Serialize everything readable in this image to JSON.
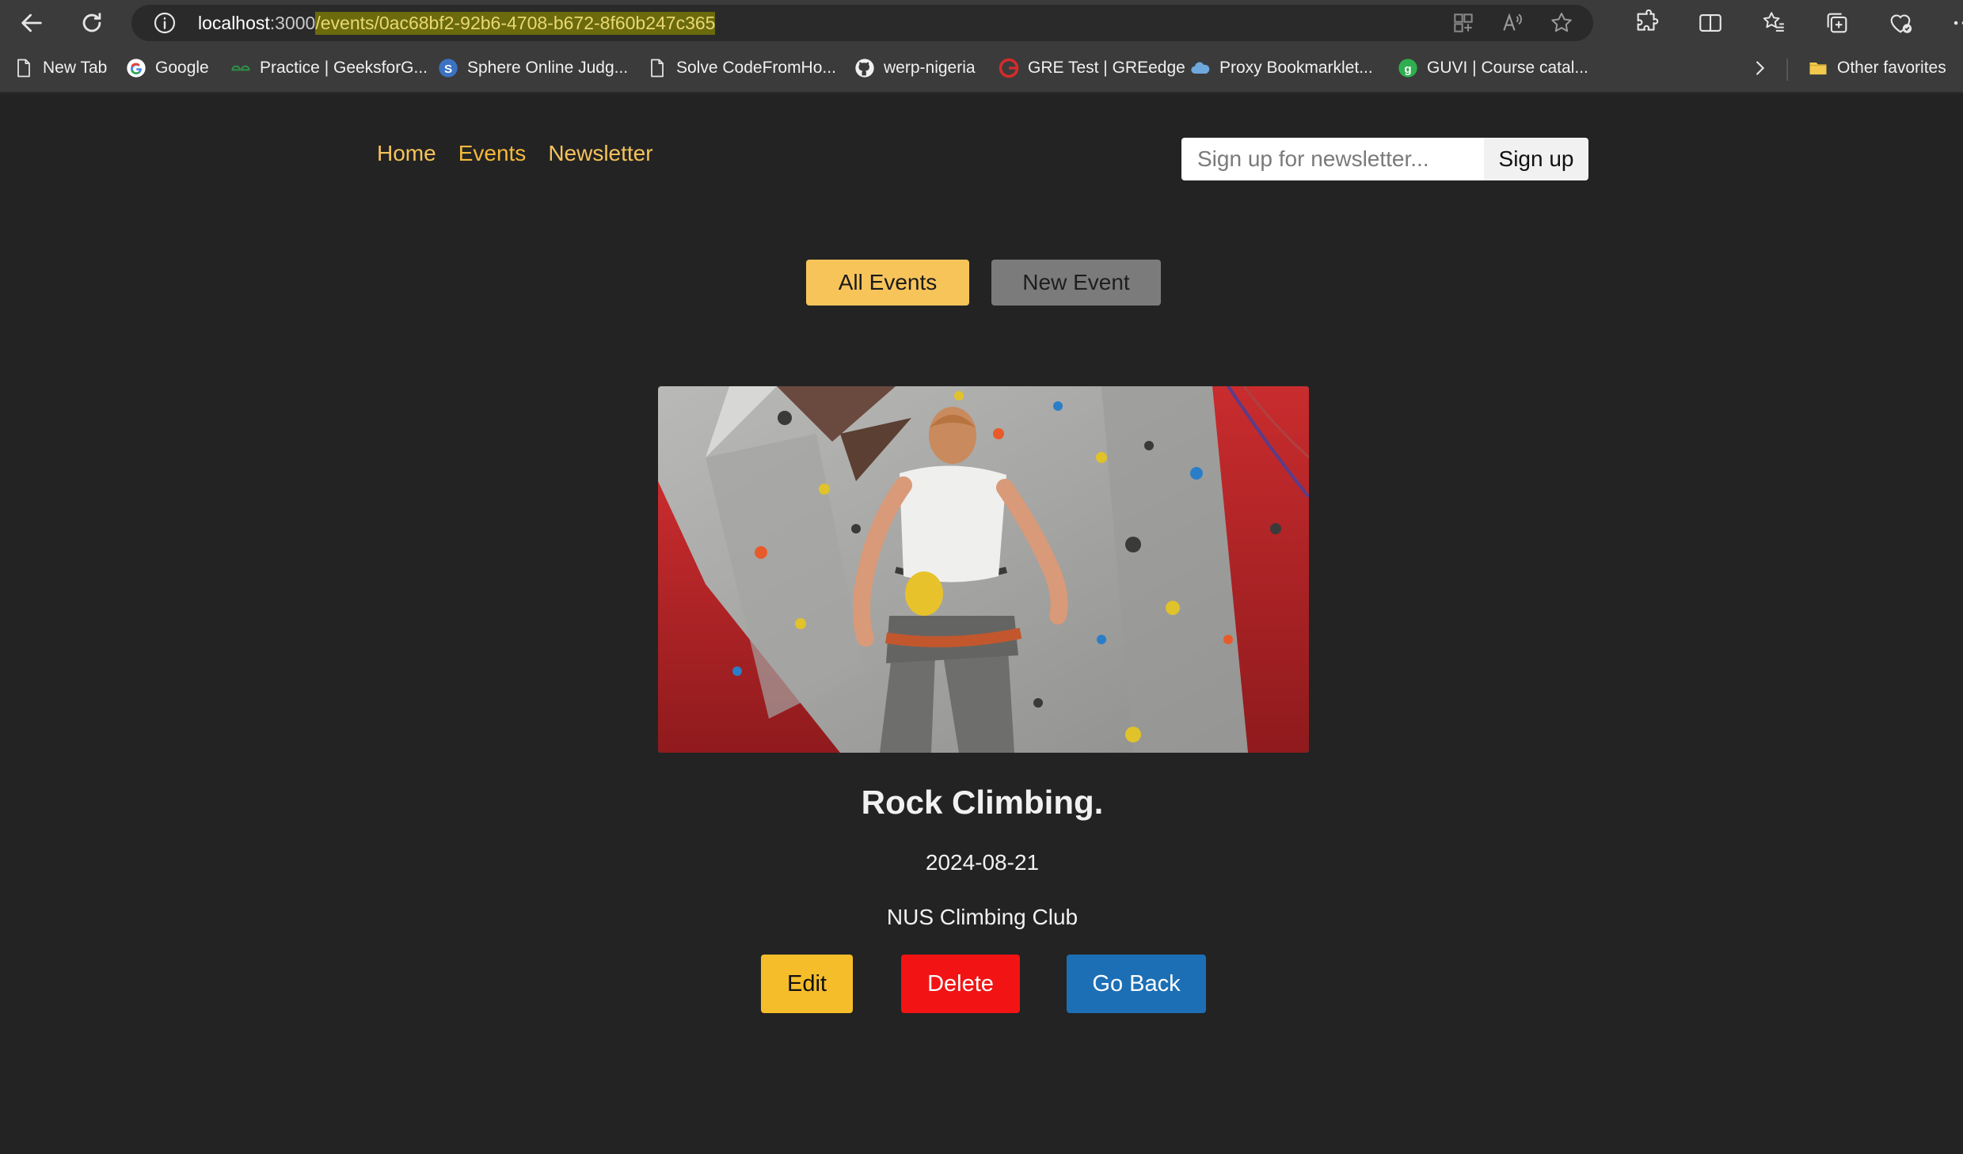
{
  "browser": {
    "url": {
      "host": "localhost",
      "port": ":3000",
      "path": "/events/0ac68bf2-92b6-4708-b672-8f60b247c365"
    },
    "bookmarks": [
      {
        "label": "New Tab",
        "icon": "page-icon"
      },
      {
        "label": "Google",
        "icon": "google-icon"
      },
      {
        "label": "Practice | GeeksforG...",
        "icon": "geeksforgeeks-icon"
      },
      {
        "label": "Sphere Online Judg...",
        "icon": "spoj-icon"
      },
      {
        "label": "Solve CodeFromHo...",
        "icon": "page-icon"
      },
      {
        "label": "werp-nigeria",
        "icon": "github-icon"
      },
      {
        "label": "GRE Test | GREedge",
        "icon": "greedge-icon"
      },
      {
        "label": "Proxy Bookmarklet...",
        "icon": "cloud-icon"
      },
      {
        "label": "GUVI | Course catal...",
        "icon": "guvi-icon"
      }
    ],
    "other_favorites": "Other favorites"
  },
  "nav": {
    "home": "Home",
    "events": "Events",
    "newsletter": "Newsletter"
  },
  "newsletter": {
    "placeholder": "Sign up for newsletter...",
    "button": "Sign up"
  },
  "tabs": {
    "all_events": "All Events",
    "new_event": "New Event"
  },
  "event": {
    "image": "rock-climbing-photo",
    "title": "Rock Climbing.",
    "date": "2024-08-21",
    "organizer": "NUS Climbing Club"
  },
  "actions": {
    "edit": "Edit",
    "delete": "Delete",
    "go_back": "Go Back"
  },
  "colors": {
    "page_bg": "#232323",
    "nav_link": "#f5c35b",
    "all_events": "#f7c45a",
    "new_event": "#7b7b7b",
    "edit": "#f6bd2b",
    "delete": "#f21414",
    "go_back": "#1d6fb5"
  }
}
